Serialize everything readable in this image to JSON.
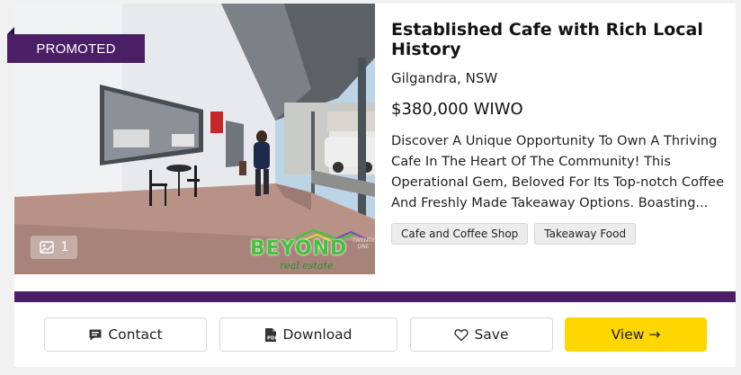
{
  "listing": {
    "badge": "PROMOTED",
    "photo_count": "1",
    "brand_logo": {
      "name": "BEYOND",
      "sub": "real estate",
      "twenty_one": "TWENTY ONE"
    },
    "title": "Established Cafe with Rich Local History",
    "location": "Gilgandra, NSW",
    "price": "$380,000 WIWO",
    "description": "Discover A Unique Opportunity To Own A Thriving Cafe In The Heart Of The Community! This Operational Gem, Beloved For Its Top-notch Coffee And Freshly Made Takeaway Options. Boasting...",
    "tags": [
      "Cafe and Coffee Shop",
      "Takeaway Food"
    ]
  },
  "actions": {
    "contact": "Contact",
    "download": "Download",
    "save": "Save",
    "view": "View →"
  },
  "colors": {
    "brand_purple": "#4a1f66",
    "view_button": "#ffd700",
    "logo_green": "#48c13e"
  },
  "icons": {
    "photo_count": "image-icon",
    "contact": "chat-bubble-icon",
    "download": "pdf-file-icon",
    "save": "heart-outline-icon"
  }
}
